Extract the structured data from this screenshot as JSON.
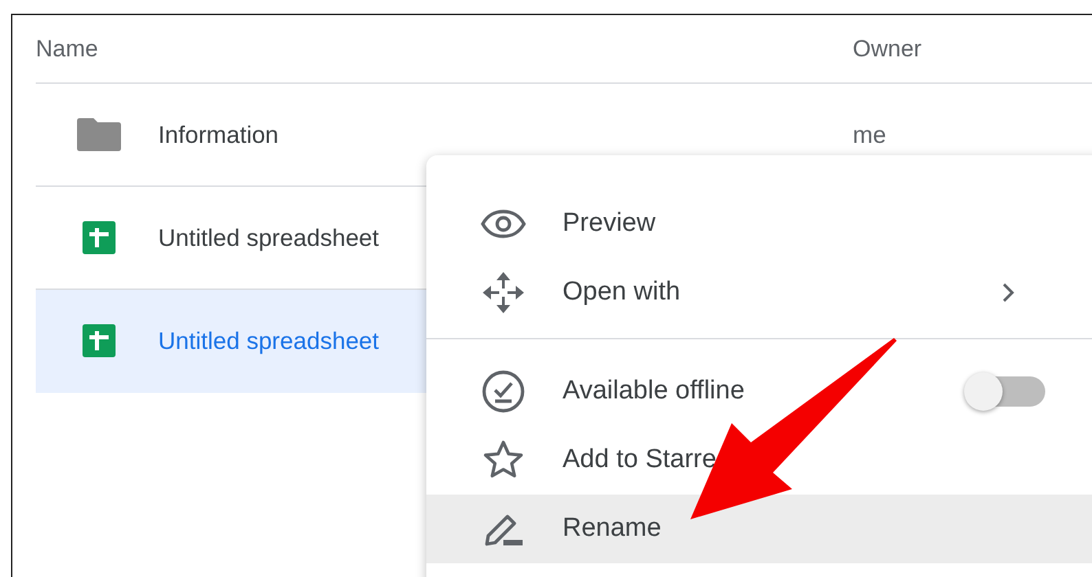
{
  "table": {
    "columns": [
      "Name",
      "Owner"
    ],
    "rows": [
      {
        "kind": "folder",
        "name": "Information",
        "owner": "me",
        "selected": false
      },
      {
        "kind": "spreadsheet",
        "name": "Untitled spreadsheet",
        "selected": false
      },
      {
        "kind": "spreadsheet",
        "name": "Untitled spreadsheet",
        "selected": true
      }
    ]
  },
  "context_menu": {
    "groups": [
      [
        {
          "kind": "action",
          "label": "Preview",
          "highlighted": false
        },
        {
          "kind": "submenu",
          "label": "Open with",
          "highlighted": false
        }
      ],
      [
        {
          "kind": "toggle",
          "label": "Available offline",
          "on": false,
          "highlighted": false
        },
        {
          "kind": "action",
          "label": "Add to Starre",
          "highlighted": false
        },
        {
          "kind": "action",
          "label": "Rename",
          "highlighted": true
        }
      ]
    ]
  }
}
